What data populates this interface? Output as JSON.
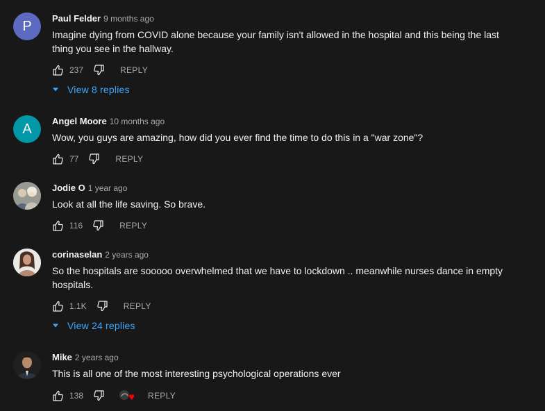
{
  "comments": [
    {
      "avatar_letter": "P",
      "avatar_color": "#5c6bc0",
      "author": "Paul Felder",
      "time": "9 months ago",
      "text_line1": "Imagine dying from COVID alone because your family isn't allowed in the hospital and this being the last",
      "text_line2": "thing you see in the hallway.",
      "likes": "237",
      "reply_label": "REPLY",
      "replies_label": "View 8 replies"
    },
    {
      "avatar_letter": "A",
      "avatar_color": "#0097a7",
      "author": "Angel Moore",
      "time": "10 months ago",
      "text_line1": "Wow, you guys are amazing, how did you ever find the time to do this in a \"war zone\"?",
      "likes": "77",
      "reply_label": "REPLY"
    },
    {
      "author": "Jodie O",
      "time": "1 year ago",
      "text_line1": "Look at all the life saving. So brave.",
      "likes": "116",
      "reply_label": "REPLY"
    },
    {
      "author": "corinaselan",
      "time": "2 years ago",
      "text_line1": "So the hospitals are sooooo overwhelmed that we have to lockdown .. meanwhile nurses dance in empty",
      "text_line2": "hospitals.",
      "likes": "1.1K",
      "reply_label": "REPLY",
      "replies_label": "View 24 replies"
    },
    {
      "author": "Mike",
      "time": "2 years ago",
      "text_line1": "This is all one of the most interesting psychological operations ever",
      "likes": "138",
      "reply_label": "REPLY",
      "creator_heart": true
    }
  ],
  "colors": {
    "background": "#181818",
    "text": "#f1f1f1",
    "secondary": "#aaaaaa",
    "link": "#3ea6ff",
    "heart": "#ff0000"
  },
  "icons": {
    "like": "thumb-up-icon",
    "dislike": "thumb-down-icon",
    "expand": "caret-down-icon",
    "heart": "heart-icon"
  }
}
